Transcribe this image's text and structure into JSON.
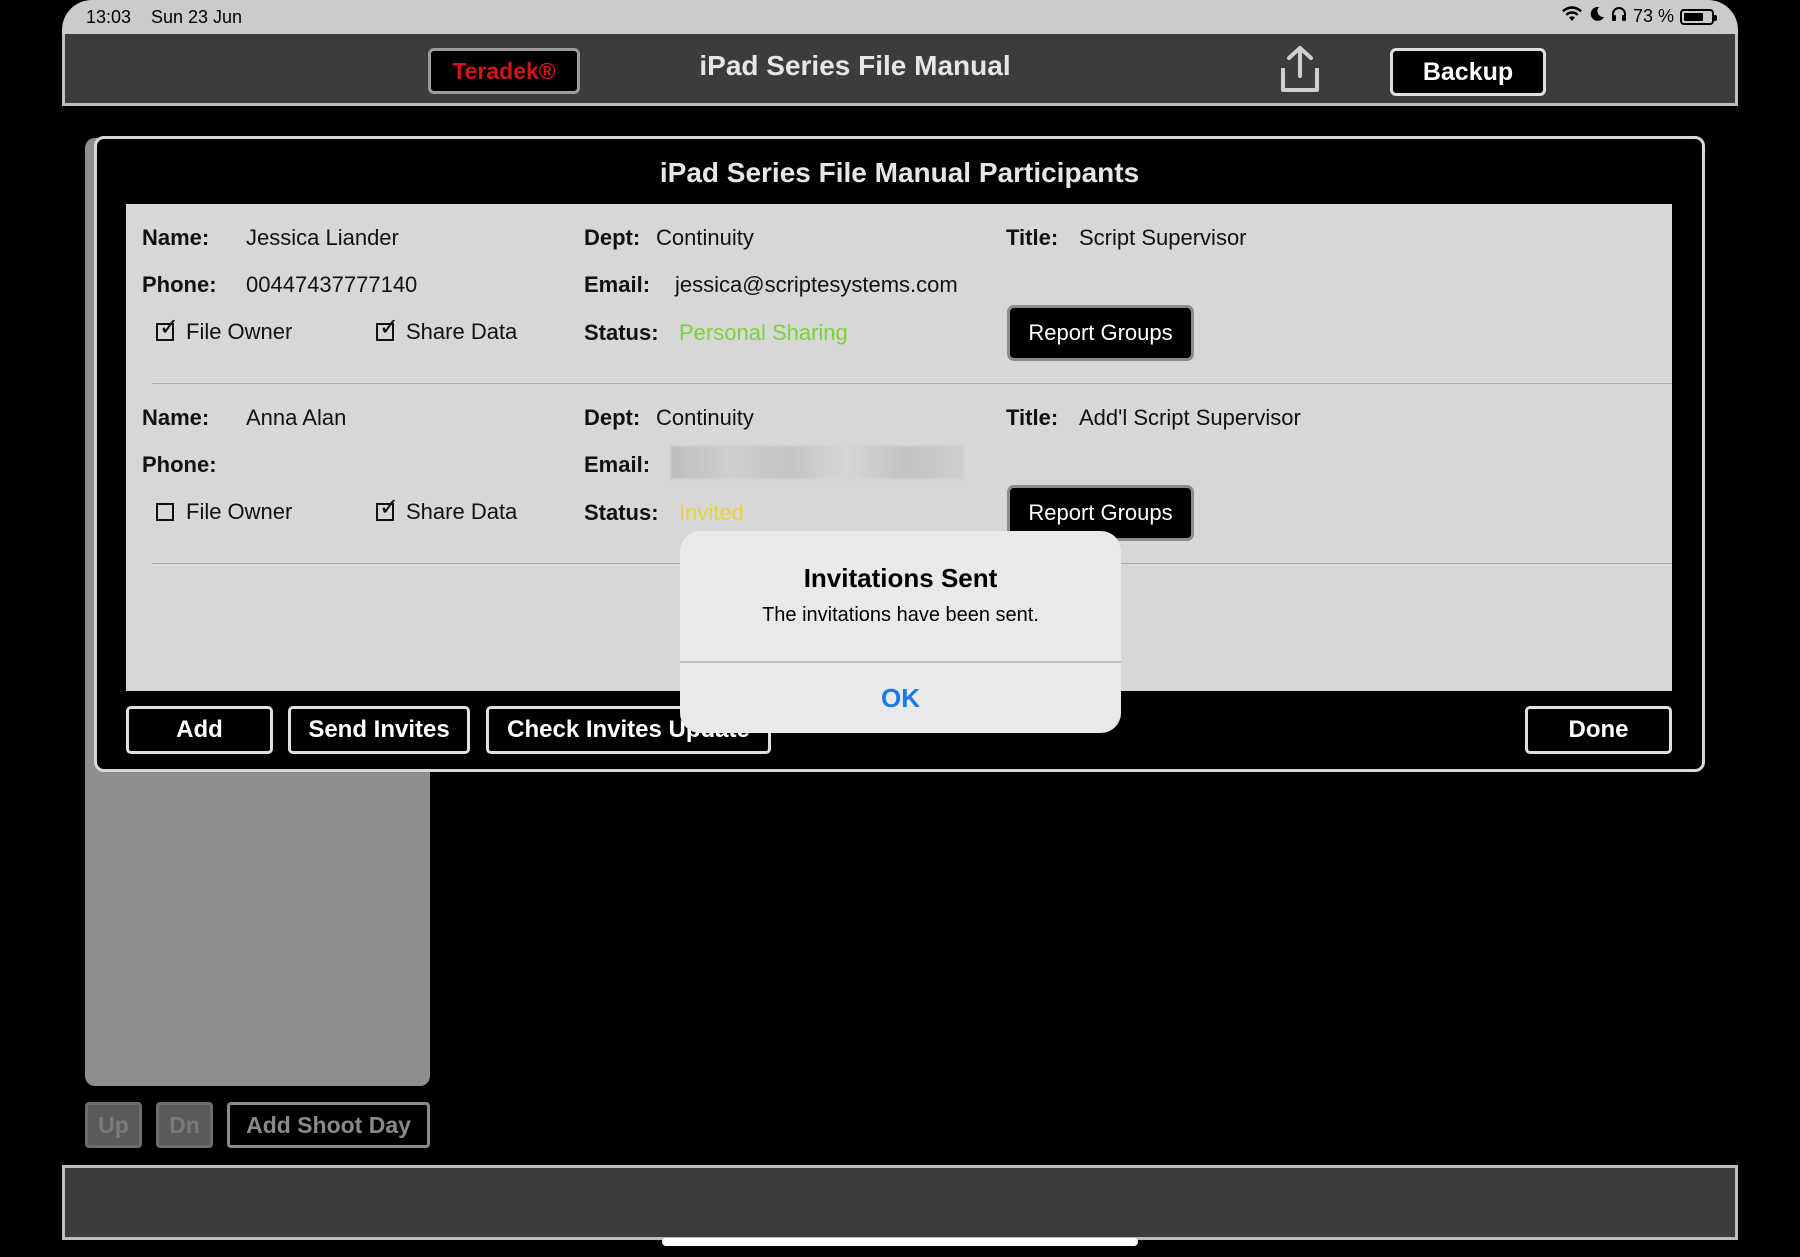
{
  "status_bar": {
    "time": "13:03",
    "date": "Sun 23 Jun",
    "battery_text": "73 %",
    "battery_level": 0.73
  },
  "nav": {
    "teradek_label": "Teradek®",
    "title": "iPad Series File Manual",
    "backup_label": "Backup"
  },
  "dialog": {
    "title": "iPad Series File Manual Participants",
    "labels": {
      "name": "Name:",
      "phone": "Phone:",
      "dept": "Dept:",
      "email": "Email:",
      "status": "Status:",
      "title": "Title:",
      "file_owner": "File Owner",
      "share_data": "Share Data",
      "report_groups": "Report Groups"
    },
    "participants": [
      {
        "name": "Jessica Liander",
        "phone": "00447437777140",
        "dept": "Continuity",
        "email": "jessica@scriptesystems.com",
        "title": "Script Supervisor",
        "status": "Personal Sharing",
        "file_owner": true,
        "share_data": true
      },
      {
        "name": "Anna Alan",
        "phone": "",
        "dept": "Continuity",
        "email": "",
        "title": "Add'l Script Supervisor",
        "status": "Invited",
        "file_owner": false,
        "share_data": true
      }
    ],
    "buttons": {
      "add": "Add",
      "send_invites": "Send Invites",
      "check_invites": "Check Invites Update",
      "done": "Done"
    }
  },
  "alert": {
    "title": "Invitations Sent",
    "message": "The invitations have been sent.",
    "ok_label": "OK"
  },
  "background": {
    "up_label": "Up",
    "dn_label": "Dn",
    "add_shoot_day_label": "Add Shoot Day"
  },
  "colors": {
    "status_personal_sharing": "#7bd13a",
    "status_invited": "#e8d23a",
    "alert_button": "#1a7ae8",
    "teradek_red": "#d0141b"
  }
}
